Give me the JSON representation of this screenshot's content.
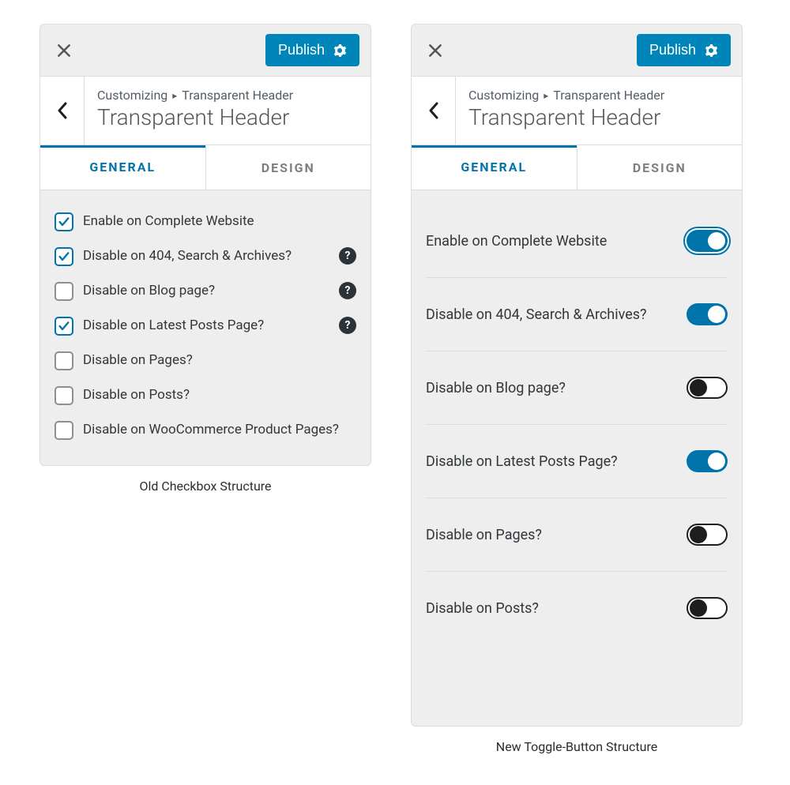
{
  "publish_label": "Publish",
  "breadcrumb": {
    "root": "Customizing",
    "leaf": "Transparent Header"
  },
  "panel_title": "Transparent Header",
  "tabs": {
    "general": "GENERAL",
    "design": "DESIGN"
  },
  "left_panel": {
    "caption": "Old Checkbox Structure",
    "options": [
      {
        "label": "Enable on Complete Website",
        "checked": true,
        "help": false
      },
      {
        "label": "Disable on 404, Search & Archives?",
        "checked": true,
        "help": true
      },
      {
        "label": "Disable on Blog page?",
        "checked": false,
        "help": true
      },
      {
        "label": "Disable on Latest Posts Page?",
        "checked": true,
        "help": true
      },
      {
        "label": "Disable on Pages?",
        "checked": false,
        "help": false
      },
      {
        "label": "Disable on Posts?",
        "checked": false,
        "help": false
      },
      {
        "label": "Disable on WooCommerce Product Pages?",
        "checked": false,
        "help": false
      }
    ]
  },
  "right_panel": {
    "caption": "New Toggle-Button Structure",
    "options": [
      {
        "label": "Enable on Complete Website",
        "on": true,
        "focused": true
      },
      {
        "label": "Disable on 404, Search & Archives?",
        "on": true,
        "focused": false
      },
      {
        "label": "Disable on Blog page?",
        "on": false,
        "focused": false
      },
      {
        "label": "Disable on Latest Posts Page?",
        "on": true,
        "focused": false
      },
      {
        "label": "Disable on Pages?",
        "on": false,
        "focused": false
      },
      {
        "label": "Disable on Posts?",
        "on": false,
        "focused": false
      }
    ]
  }
}
